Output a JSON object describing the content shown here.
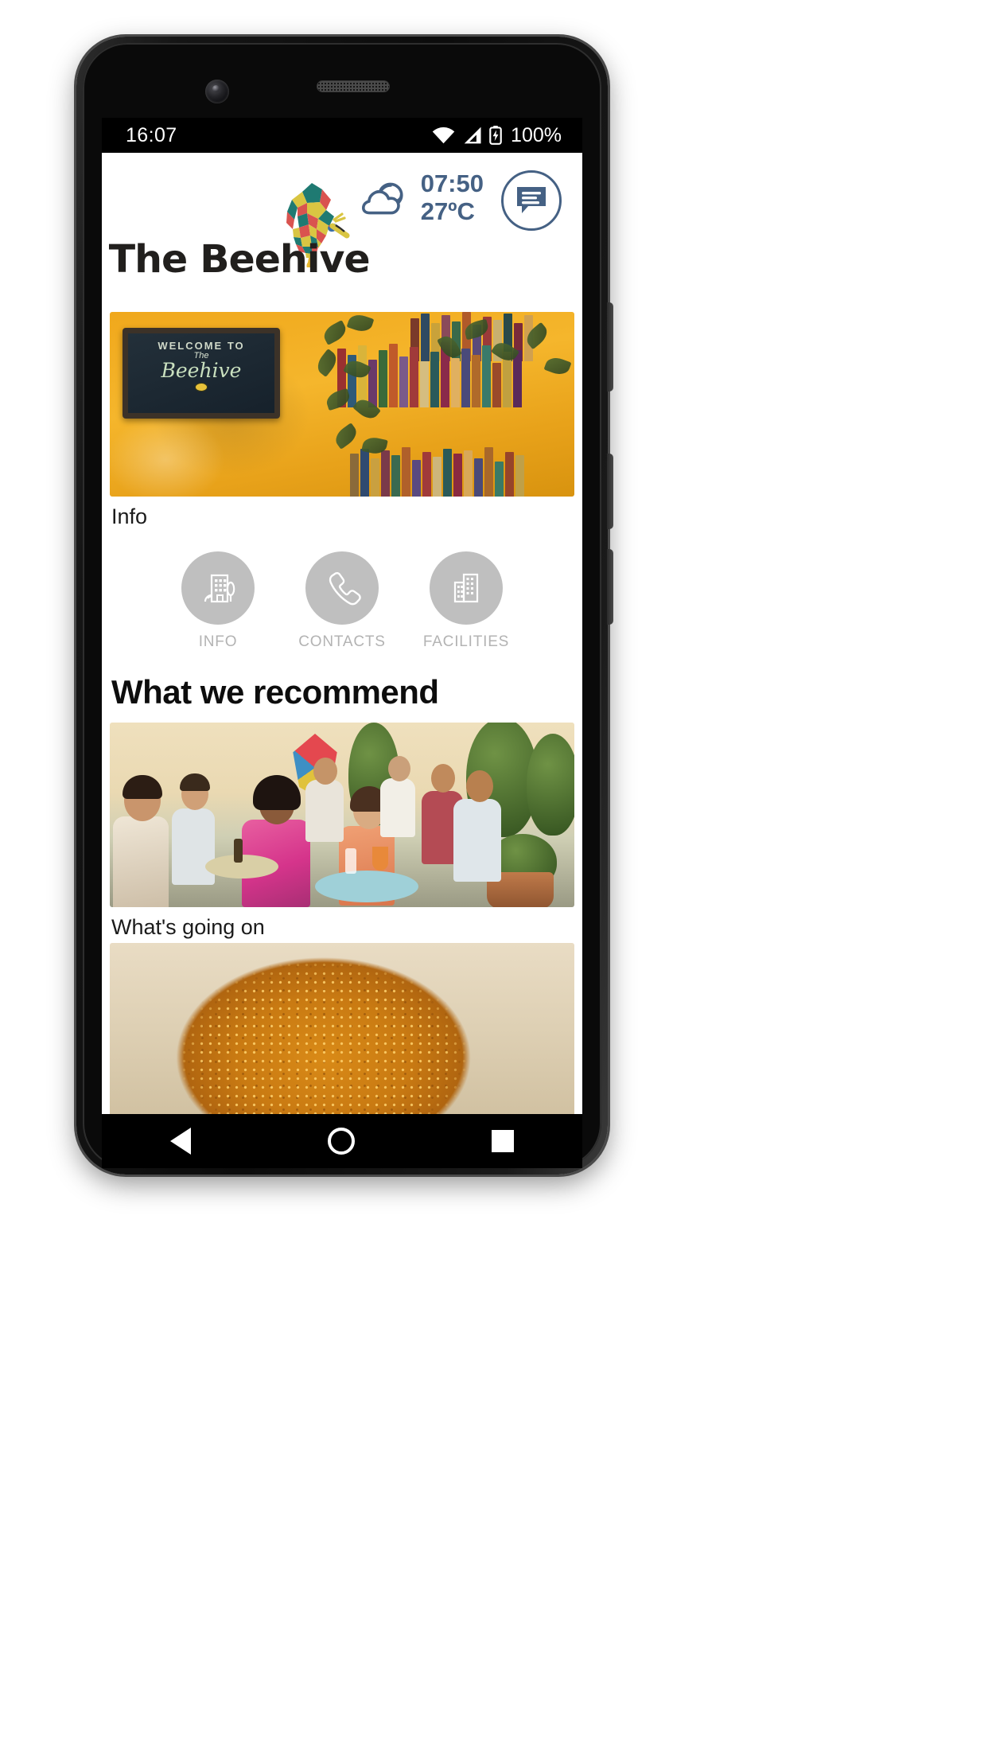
{
  "status_bar": {
    "time": "16:07",
    "battery_percent": "100%",
    "icons": [
      "wifi-icon",
      "cellular-signal-icon",
      "battery-charging-icon"
    ]
  },
  "header": {
    "brand_title": "The Beehive",
    "logo_icon": "beehive-mosaic-logo",
    "weather": {
      "icon": "cloudy-icon",
      "time": "07:50",
      "temperature": "27ºC"
    },
    "chat_button_icon": "chat-message-icon",
    "accent_color": "#456184"
  },
  "content": {
    "cards": [
      {
        "caption": "Info",
        "image_name": "welcome-to-the-beehive-wall-photo"
      },
      {
        "caption": "What's going on",
        "image_name": "courtyard-guests-photo"
      },
      {
        "caption": "",
        "image_name": "fried-food-dish-photo"
      }
    ],
    "quick_actions": [
      {
        "label": "INFO",
        "icon": "building-info-icon"
      },
      {
        "label": "CONTACTS",
        "icon": "phone-handset-icon"
      },
      {
        "label": "FACILITIES",
        "icon": "office-building-icon"
      }
    ],
    "section_heading": "What we recommend",
    "welcome_sign": {
      "line1": "WELCOME TO",
      "line2": "The",
      "line3": "Beehive",
      "bee_icon": "bee-icon"
    }
  },
  "nav_bar": {
    "back_label": "back-button",
    "home_label": "home-button",
    "recents_label": "recents-button"
  }
}
